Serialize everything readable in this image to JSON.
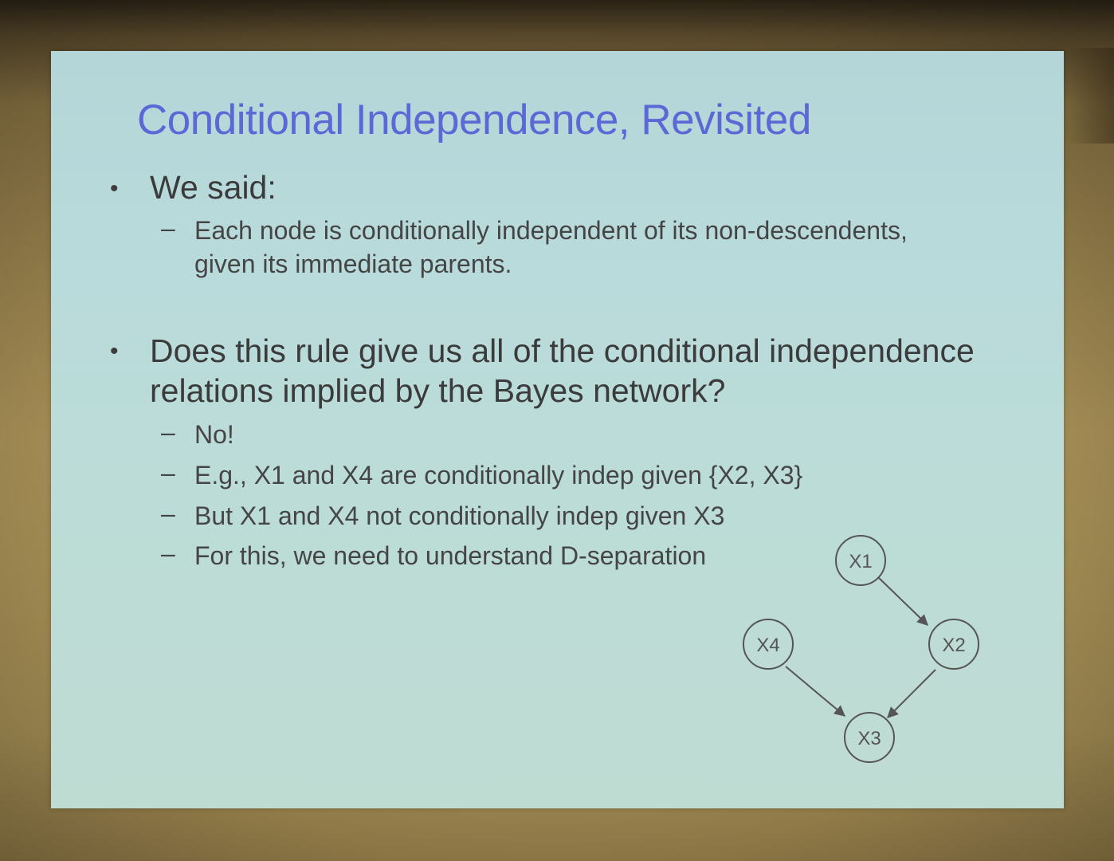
{
  "slide": {
    "title": "Conditional Independence, Revisited",
    "bullet_symbol": "•",
    "dash_symbol": "–",
    "bullets": [
      {
        "text": "We said:",
        "subitems": [
          "Each node is conditionally independent of its non-descendents,",
          "given its immediate parents."
        ]
      },
      {
        "text_line1": "Does this rule give us all of the conditional independence",
        "text_line2": "relations implied by the Bayes network?",
        "subitems": [
          "No!",
          "E.g., X1 and X4 are conditionally indep given {X2, X3}",
          "But X1 and X4 not conditionally indep given X3",
          "For this, we need to understand D-separation"
        ]
      }
    ],
    "graph": {
      "nodes": [
        "X1",
        "X2",
        "X3",
        "X4"
      ],
      "edges": [
        [
          "X1",
          "X2"
        ],
        [
          "X4",
          "X3"
        ],
        [
          "X2",
          "X3"
        ]
      ]
    }
  }
}
